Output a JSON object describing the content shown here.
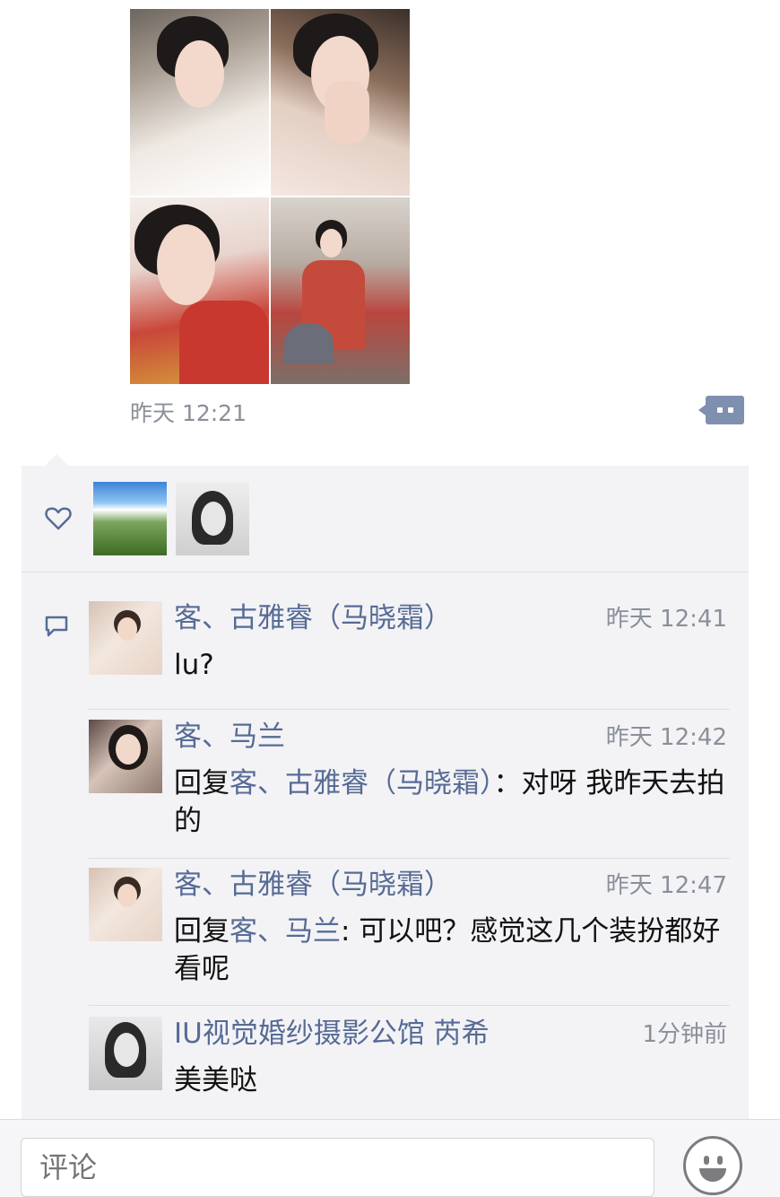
{
  "post": {
    "time": "昨天 12:21",
    "photos": [
      "bride-lace-gown-photo",
      "bride-hand-on-face-photo",
      "bride-red-dress-photo",
      "bride-mirror-selfie-photo"
    ]
  },
  "likes": {
    "icon": "heart-icon",
    "avatars": [
      "mountain-landscape-avatar",
      "salon-portrait-avatar"
    ]
  },
  "comments": [
    {
      "name": "客、古雅睿（马晓霜）",
      "time": "昨天 12:41",
      "text": "lu?",
      "reply_prefix": "",
      "reply_to": "",
      "avatar": "salon-avatar"
    },
    {
      "name": "客、马兰",
      "time": "昨天 12:42",
      "reply_prefix": "回复",
      "reply_to": "客、古雅睿（马晓霜）",
      "text": "：对呀 我昨天去拍的",
      "avatar": "woman-avatar"
    },
    {
      "name": "客、古雅睿（马晓霜）",
      "time": "昨天 12:47",
      "reply_prefix": "回复",
      "reply_to": "客、马兰",
      "text": ": 可以吧？感觉这几个装扮都好看呢",
      "avatar": "salon-avatar"
    },
    {
      "name": "IU视觉婚纱摄影公馆  芮希",
      "time": "1分钟前",
      "text": "美美哒",
      "reply_prefix": "",
      "reply_to": "",
      "avatar": "portrait-avatar"
    }
  ],
  "input": {
    "placeholder": "评论"
  },
  "colors": {
    "link": "#576b95",
    "panel": "#f3f3f6",
    "more_button": "#7e8fb0"
  }
}
